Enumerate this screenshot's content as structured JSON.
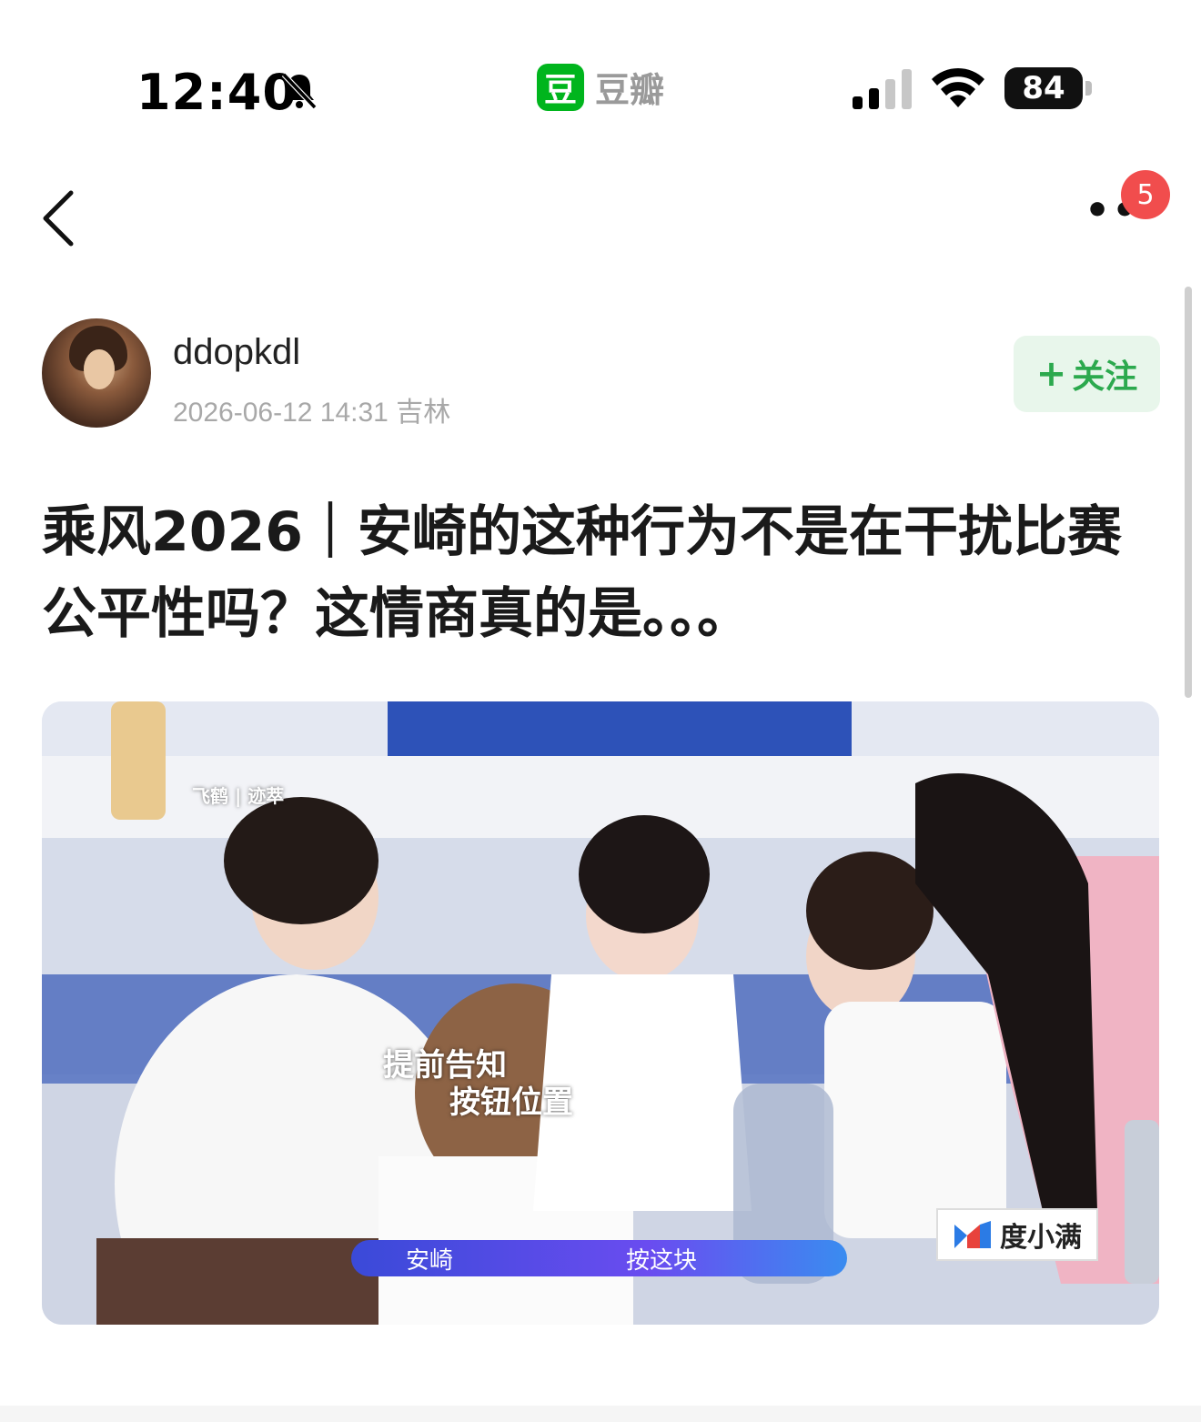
{
  "status_bar": {
    "time": "12:40",
    "app_logo_char": "豆",
    "app_name": "豆瓣",
    "battery": "84",
    "icons": [
      "bell-slash-icon",
      "signal-icon",
      "wifi-icon",
      "battery-icon"
    ]
  },
  "nav": {
    "back_icon": "chevron-left-icon",
    "more_label": "•••",
    "notification_count": "5"
  },
  "author": {
    "username": "ddopkdl",
    "meta": "2026-06-12 14:31 吉林",
    "follow_label": "关注",
    "follow_plus": "+"
  },
  "post": {
    "title": "乘风2026｜安崎的这种行为不是在干扰比赛公平性吗？这情商真的是。。。",
    "image": {
      "overlay_line1": "提前告知",
      "overlay_line2": "按钮位置",
      "brand_logo": "度小满",
      "lower_third_name": "安崎",
      "lower_third_text": "按这块",
      "sponsor_text": "飞鹤 | 迹萃"
    }
  },
  "colors": {
    "accent_green": "#00b51d",
    "follow_text": "#2ca94e",
    "follow_bg": "#e8f6eb",
    "badge_red": "#f14d4d"
  }
}
